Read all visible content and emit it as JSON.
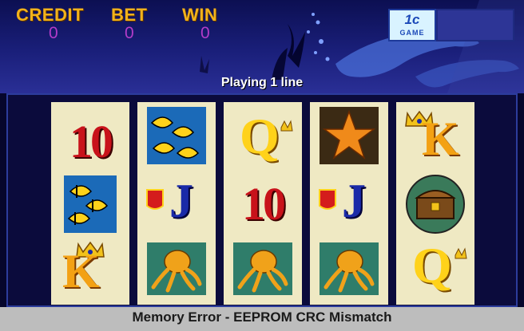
{
  "meters": {
    "credit_label": "CREDIT",
    "bet_label": "BET",
    "win_label": "WIN",
    "credit_value": "0",
    "bet_value": "0",
    "win_value": "0"
  },
  "logo": {
    "main": "1c",
    "sub": "GAME"
  },
  "status": "Playing 1 line",
  "reels": [
    [
      "10",
      "butterfly-fish",
      "K"
    ],
    [
      "butterfly-fish",
      "J",
      "octopus"
    ],
    [
      "Q",
      "10",
      "octopus"
    ],
    [
      "starfish",
      "J",
      "octopus"
    ],
    [
      "K",
      "treasure-chest",
      "Q"
    ]
  ],
  "footer": "Memory Error - EEPROM CRC Mismatch",
  "colors": {
    "meter_label": "#f2b21a",
    "meter_value": "#b23cc8",
    "reel_bg": "#efe9c3"
  }
}
